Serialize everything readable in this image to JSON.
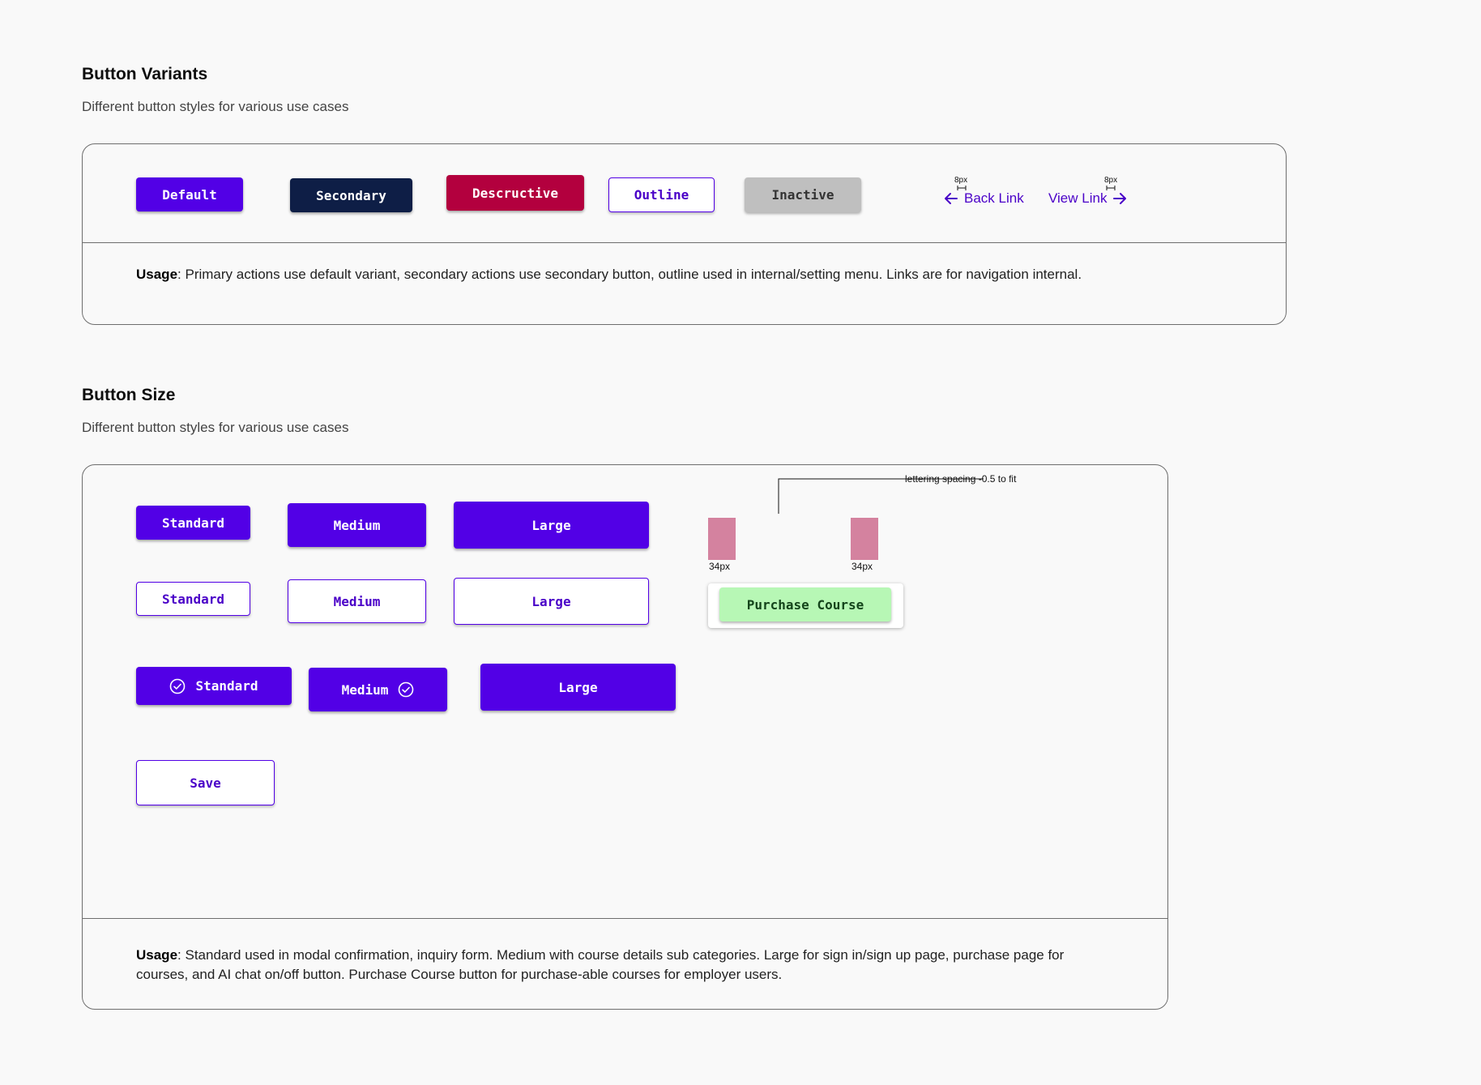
{
  "variants": {
    "title": "Button Variants",
    "subtitle": "Different button styles for various use cases",
    "buttons": {
      "default": "Default",
      "secondary": "Secondary",
      "destructive": "Descructive",
      "outline": "Outline",
      "inactive": "Inactive"
    },
    "links": {
      "back": "Back Link",
      "view": "View Link",
      "back_gap": "8px",
      "view_gap": "8px"
    },
    "usage_label": "Usage",
    "usage_text": ": Primary actions use default variant, secondary actions use secondary button, outline used in internal/setting menu. Links are for navigation internal."
  },
  "sizes": {
    "title": "Button Size",
    "subtitle": "Different button styles for various use cases",
    "filled": {
      "standard": "Standard",
      "medium": "Medium",
      "large": "Large"
    },
    "outline": {
      "standard": "Standard",
      "medium": "Medium",
      "large": "Large"
    },
    "with_icon": {
      "standard": "Standard",
      "medium": "Medium",
      "large": "Large"
    },
    "save": "Save",
    "annotation": {
      "note": "lettering spacing -0.5 to fit",
      "left_padding": "34px",
      "right_padding": "34px",
      "purchase": "Purchase Course"
    },
    "usage_label": "Usage",
    "usage_text": ": Standard used in modal confirmation, inquiry form. Medium with course details sub categories. Large for sign in/sign up page, purchase page for courses, and AI chat on/off button. Purchase Course button for purchase-able courses for employer users."
  },
  "colors": {
    "primary": "#5200e6",
    "secondary": "#0e1e46",
    "destructive": "#b3003e",
    "inactive": "#bfbfbf",
    "purchase": "#b7f7b5",
    "link": "#4a00c8"
  },
  "icons": {
    "back": "arrow-left-icon",
    "view": "arrow-right-icon",
    "check": "check-circle-icon"
  }
}
